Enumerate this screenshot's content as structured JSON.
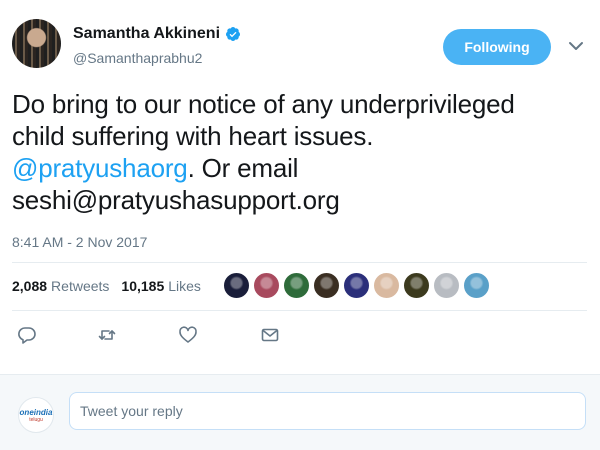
{
  "author": {
    "display_name": "Samantha Akkineni",
    "handle": "@Samanthaprabhu2",
    "verified": true
  },
  "follow_button": {
    "label": "Following"
  },
  "tweet": {
    "text_line1": "Do bring to our notice of any underprivileged",
    "text_line2": "child suffering with heart issues.",
    "mention": "@pratyushaorg",
    "text_line3_rest": ". Or email",
    "text_line4": "seshi@pratyushasupport.org",
    "timestamp": "8:41 AM - 2 Nov 2017"
  },
  "stats": {
    "retweets_count": "2,088",
    "retweets_label": "Retweets",
    "likes_count": "10,185",
    "likes_label": "Likes"
  },
  "likers": [
    {
      "name": "liker-1",
      "color": "#1a1e3a"
    },
    {
      "name": "liker-2",
      "color": "#a84a5e"
    },
    {
      "name": "liker-3",
      "color": "#2e6b3a"
    },
    {
      "name": "liker-4",
      "color": "#3a2e22"
    },
    {
      "name": "liker-5",
      "color": "#2b2f7a"
    },
    {
      "name": "liker-6",
      "color": "#d9b9a0"
    },
    {
      "name": "liker-7",
      "color": "#3c3a1e"
    },
    {
      "name": "liker-8",
      "color": "#b8bcc2"
    },
    {
      "name": "liker-9",
      "color": "#5aa0c8"
    }
  ],
  "actions": [
    "reply-icon",
    "retweet-icon",
    "like-icon",
    "direct-message-icon"
  ],
  "reply": {
    "placeholder": "Tweet your reply",
    "avatar_logo_main": "oneindia",
    "avatar_logo_sub": "telugu"
  },
  "colors": {
    "accent": "#1da1f2",
    "follow_bg": "#4ab3f4",
    "muted": "#657786",
    "icon": "#657786"
  }
}
